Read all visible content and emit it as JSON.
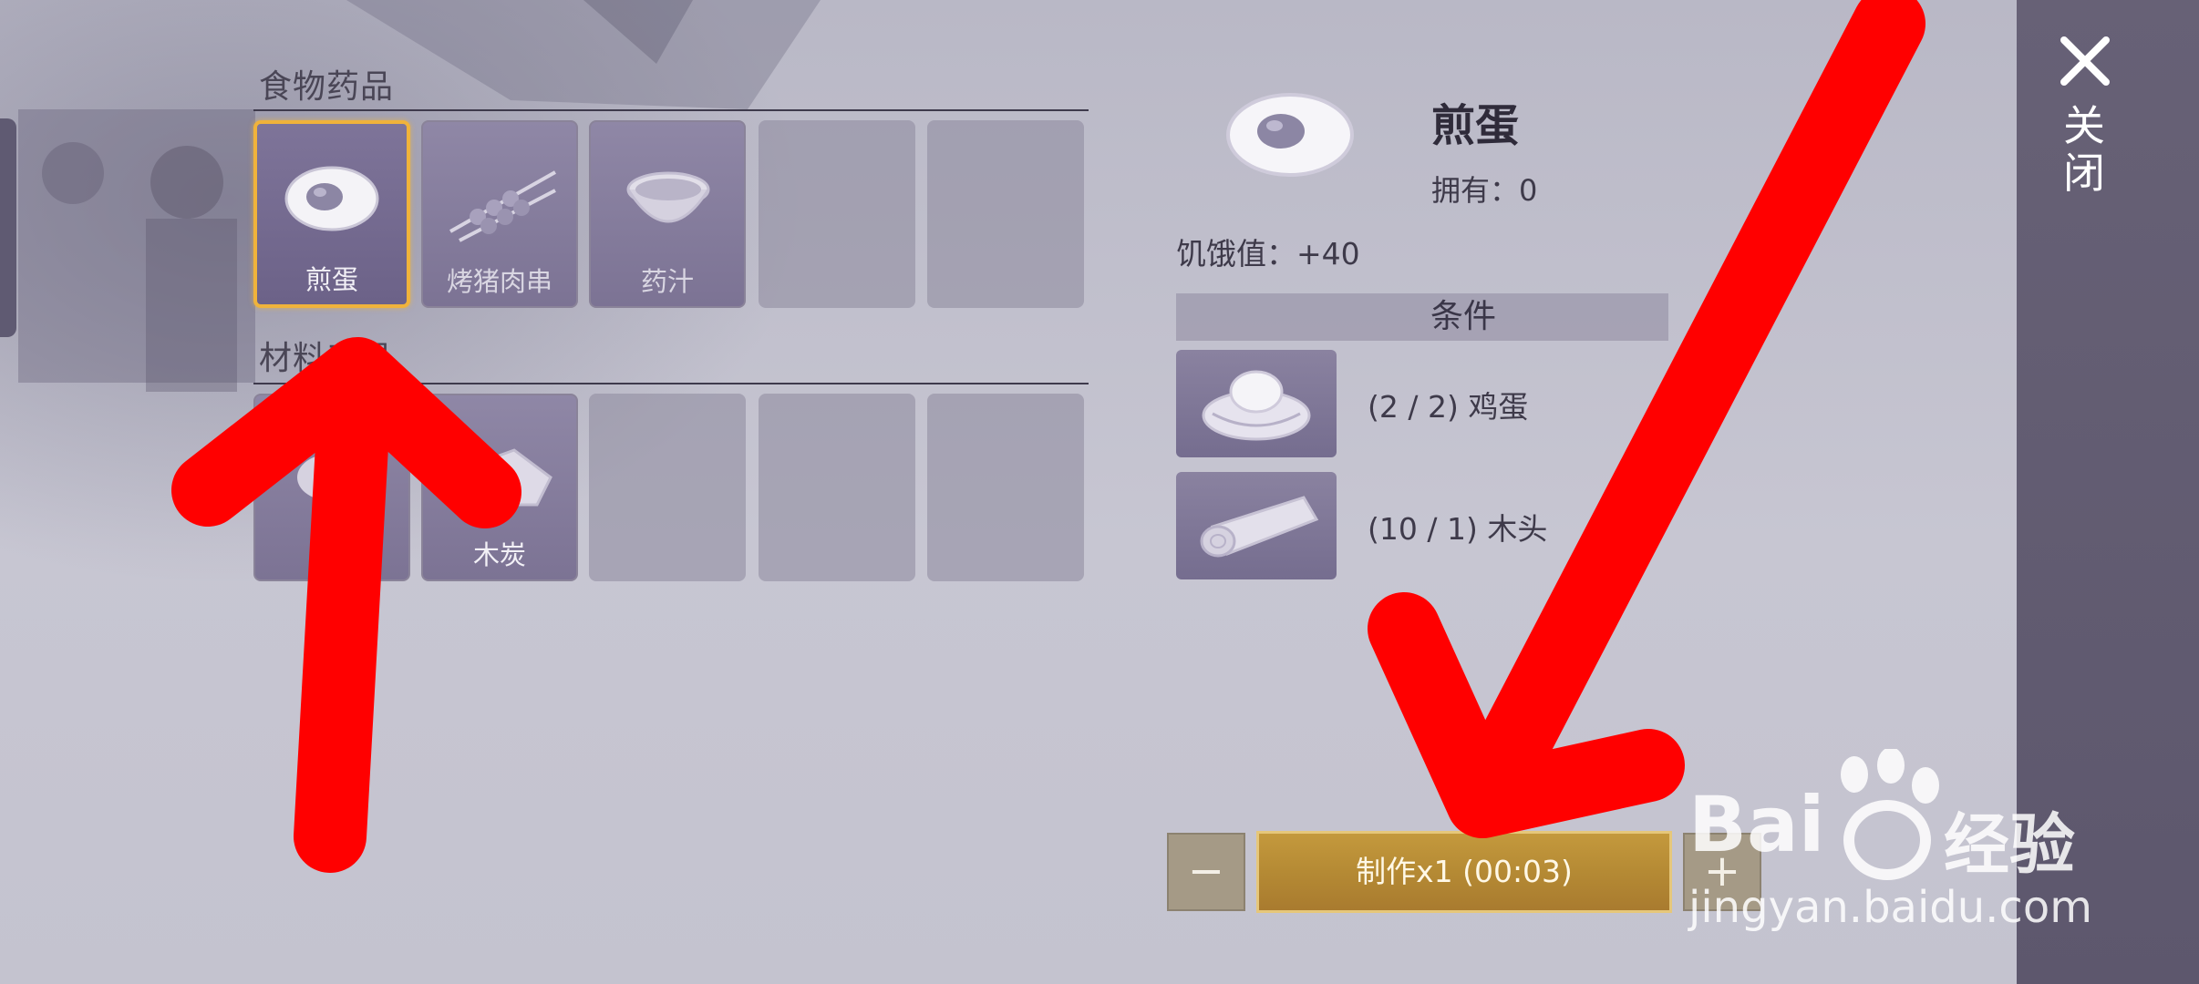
{
  "sections": {
    "food": {
      "title": "食物药品"
    },
    "materials": {
      "title": "材料工具"
    }
  },
  "food_items": [
    {
      "label": "煎蛋",
      "icon": "fried-egg-icon",
      "selected": true
    },
    {
      "label": "烤猪肉串",
      "icon": "pork-skewer-icon",
      "selected": false
    },
    {
      "label": "药汁",
      "icon": "medicine-bowl-icon",
      "selected": false
    },
    {
      "label": "",
      "icon": "",
      "selected": false
    },
    {
      "label": "",
      "icon": "",
      "selected": false
    }
  ],
  "material_items": [
    {
      "label": "",
      "icon": "bowl-icon"
    },
    {
      "label": "木炭",
      "icon": "charcoal-icon"
    },
    {
      "label": "",
      "icon": ""
    },
    {
      "label": "",
      "icon": ""
    },
    {
      "label": "",
      "icon": ""
    }
  ],
  "detail": {
    "name": "煎蛋",
    "owned": "拥有：0",
    "hunger": "饥饿值：+40",
    "conditions_title": "条件",
    "materials": [
      {
        "text": "(2 / 2) 鸡蛋",
        "icon": "egg-nest-icon"
      },
      {
        "text": "(10 / 1) 木头",
        "icon": "wood-log-icon"
      }
    ]
  },
  "craft": {
    "minus": "−",
    "make": "制作x1 (00:03)",
    "plus": "+"
  },
  "close": {
    "label": "关闭"
  },
  "watermark": {
    "brand": "Bai",
    "brand2": "经验",
    "url": "jingyan.baidu.com"
  },
  "colors": {
    "selected_border": "#f0b33b",
    "make_button": "#b58a34",
    "annotation_arrow": "#ff0000"
  }
}
